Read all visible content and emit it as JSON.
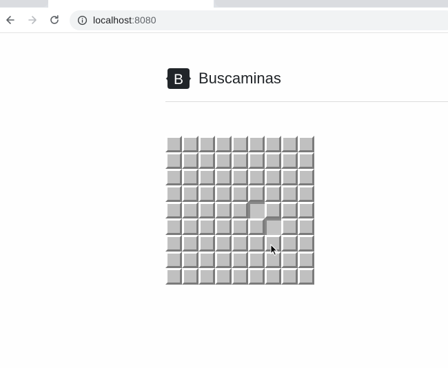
{
  "browser": {
    "url_host": "localhost",
    "url_port": ":8080",
    "icons": {
      "back": "back-arrow-icon",
      "forward": "forward-arrow-icon",
      "reload": "reload-icon",
      "site_info": "info-icon"
    }
  },
  "header": {
    "logo_letter": "B",
    "title": "Buscaminas"
  },
  "board": {
    "rows": 9,
    "cols": 9,
    "revealed_cells": [
      [
        4,
        5
      ],
      [
        5,
        6
      ]
    ],
    "colors": {
      "cell": "#c0c0c0",
      "highlight": "#ffffff",
      "shadow": "#7b7b7b"
    }
  }
}
